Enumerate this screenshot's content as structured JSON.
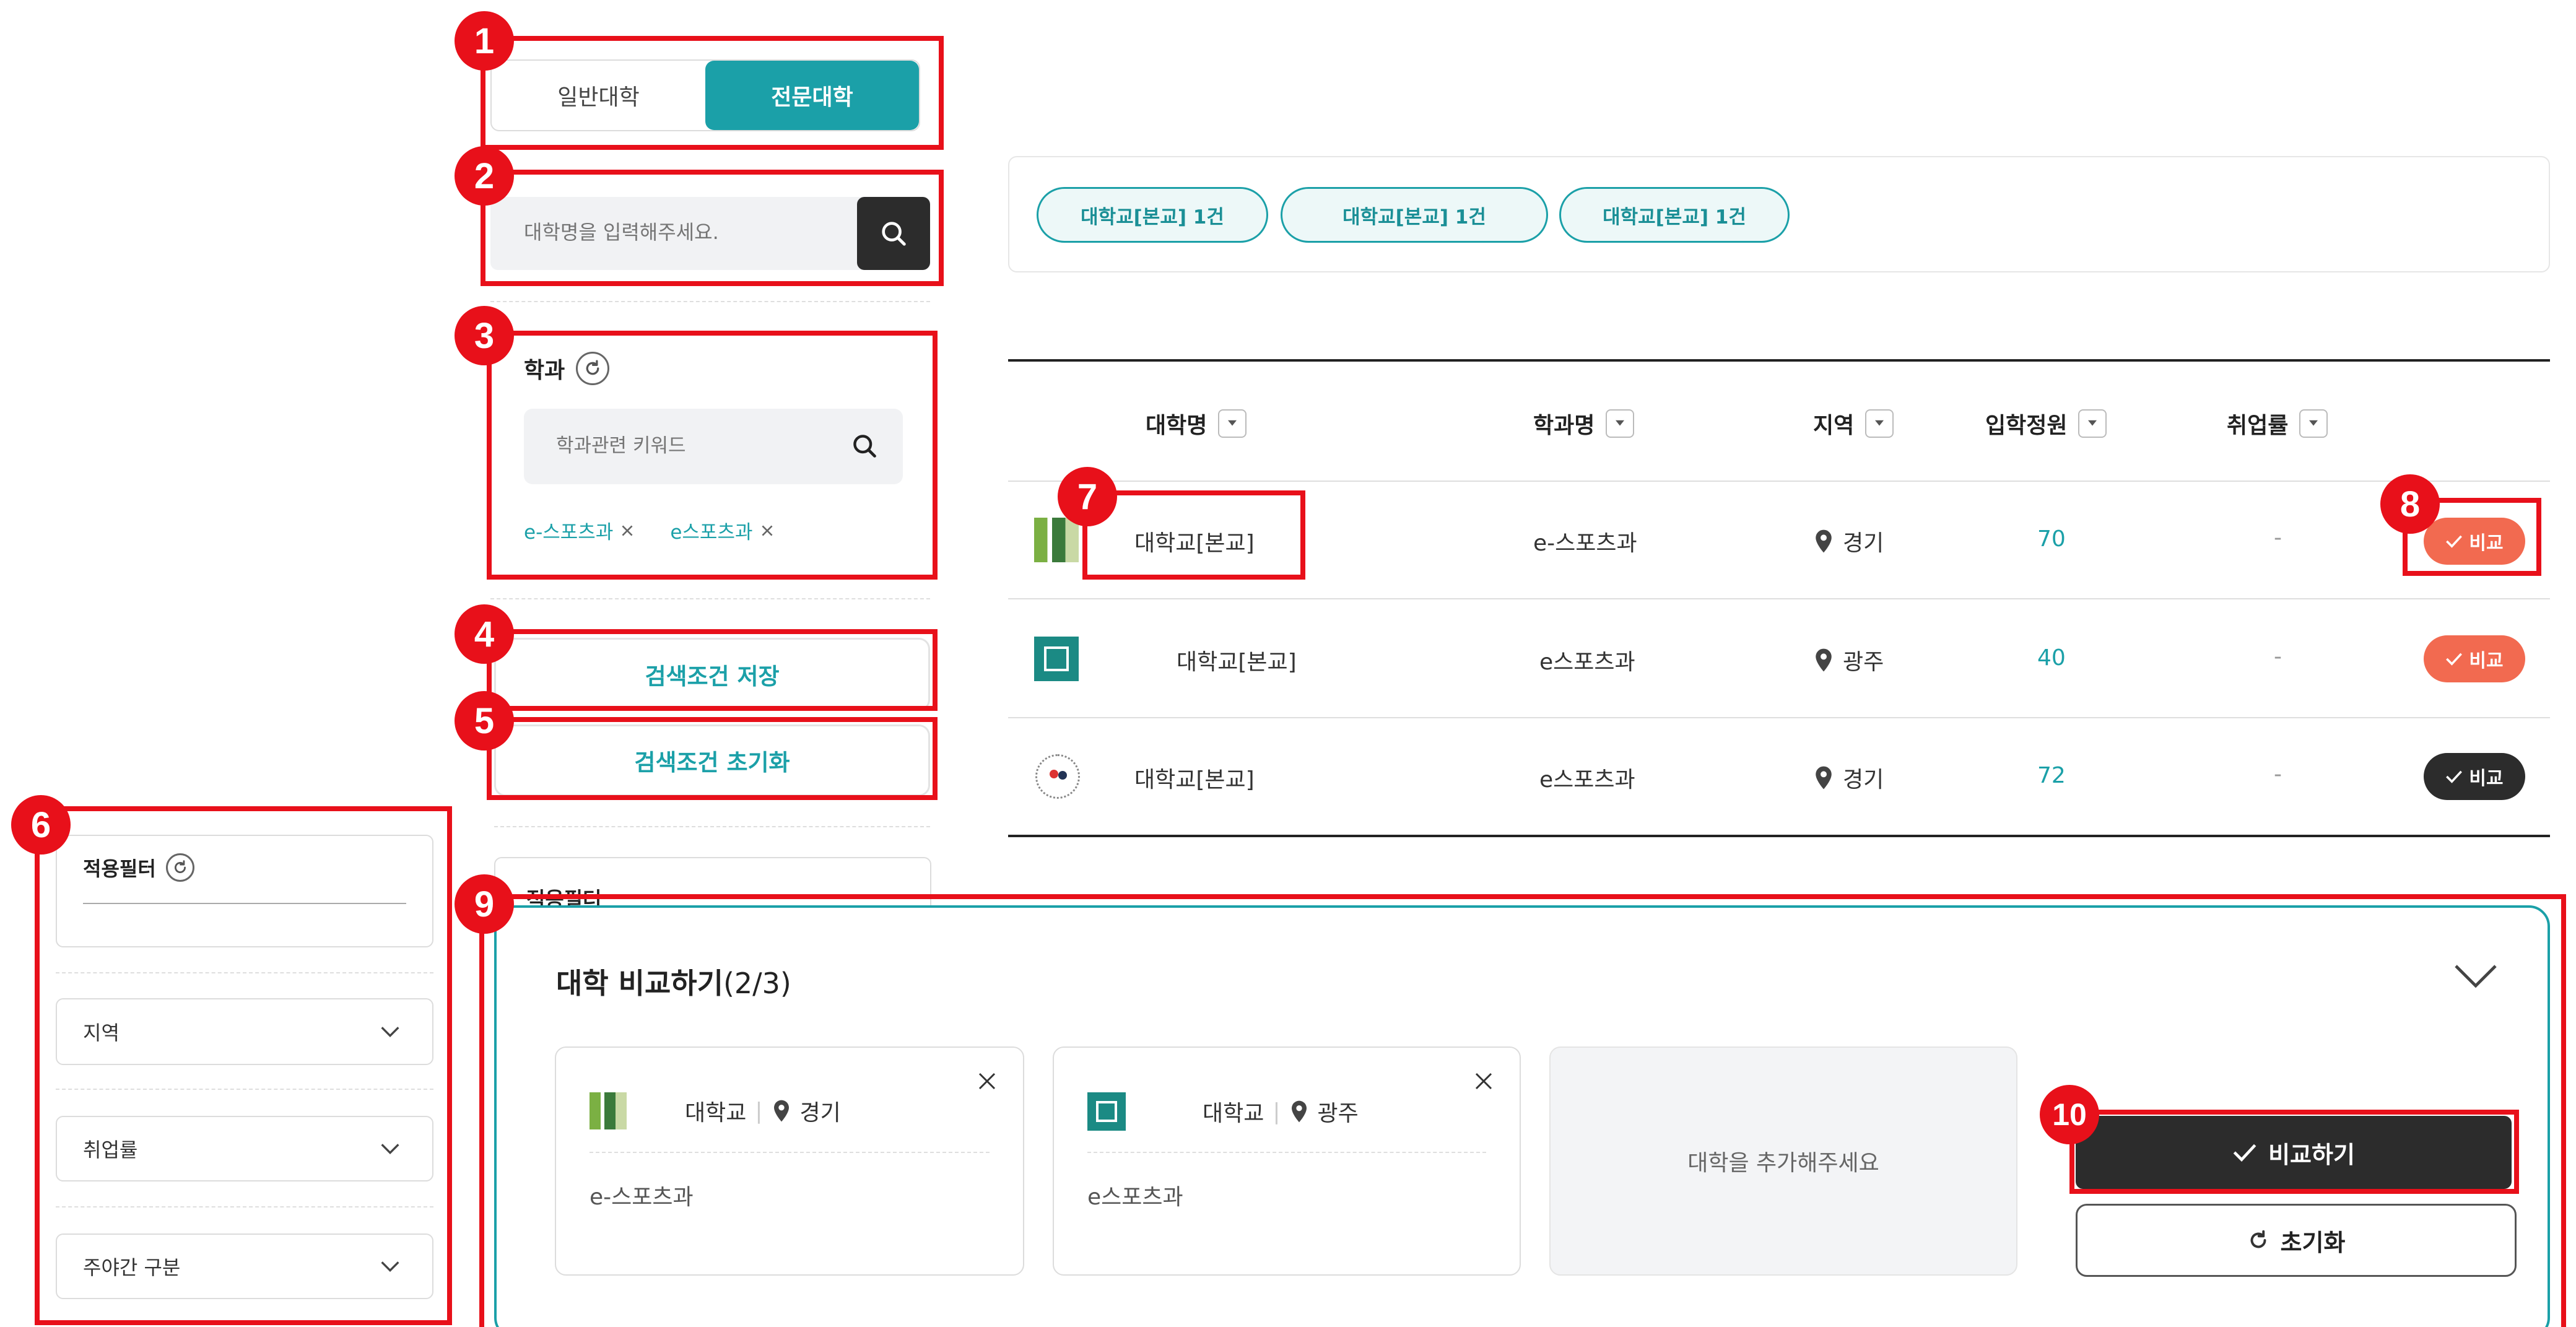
{
  "toggle": {
    "general": "일반대학",
    "specialized": "전문대학"
  },
  "university_search": {
    "placeholder": "대학명을 입력해주세요."
  },
  "department": {
    "title": "학과",
    "search_placeholder": "학과관련 키워드",
    "chips": [
      "e-스포츠과",
      "e스포츠과"
    ]
  },
  "buttons": {
    "save_conditions": "검색조건 저장",
    "reset_conditions": "검색조건 초기화"
  },
  "applied_filter": {
    "title": "적용필터",
    "behind_title": "적용필터"
  },
  "left_filters": {
    "region": "지역",
    "employment": "취업률",
    "day_night": "주야간 구분"
  },
  "result_tags": [
    "대학교[본교] 1건",
    "대학교[본교] 1건",
    "대학교[본교] 1건"
  ],
  "table": {
    "headers": [
      "대학명",
      "학과명",
      "지역",
      "입학정원",
      "취업률"
    ],
    "rows": [
      {
        "university": "대학교[본교]",
        "department": "e-스포츠과",
        "region": "경기",
        "capacity": "70",
        "employment": "-",
        "compare": "비교",
        "compare_state": "selected"
      },
      {
        "university": "대학교[본교]",
        "department": "e스포츠과",
        "region": "광주",
        "capacity": "40",
        "employment": "-",
        "compare": "비교",
        "compare_state": "selected"
      },
      {
        "university": "대학교[본교]",
        "department": "e스포츠과",
        "region": "경기",
        "capacity": "72",
        "employment": "-",
        "compare": "비교",
        "compare_state": "default"
      }
    ]
  },
  "compare_panel": {
    "title": "대학 비교하기",
    "count": "(2/3)",
    "cards": [
      {
        "name": "대학교",
        "region": "경기",
        "department": "e-스포츠과"
      },
      {
        "name": "대학교",
        "region": "광주",
        "department": "e스포츠과"
      }
    ],
    "empty_slot": "대학을 추가해주세요",
    "compare_button": "비교하기",
    "reset_button": "초기화"
  },
  "annotations": [
    "1",
    "2",
    "3",
    "4",
    "5",
    "6",
    "7",
    "8",
    "9",
    "10"
  ],
  "colors": {
    "accent": "#1ba0a8",
    "compare_selected": "#f26a50",
    "dark": "#2c2c2c",
    "annotation_red": "#e8101a"
  },
  "icons": [
    "search-icon",
    "refresh-icon",
    "close-icon",
    "chevron-down-icon",
    "location-pin-icon",
    "check-icon",
    "sort-dropdown-icon"
  ]
}
